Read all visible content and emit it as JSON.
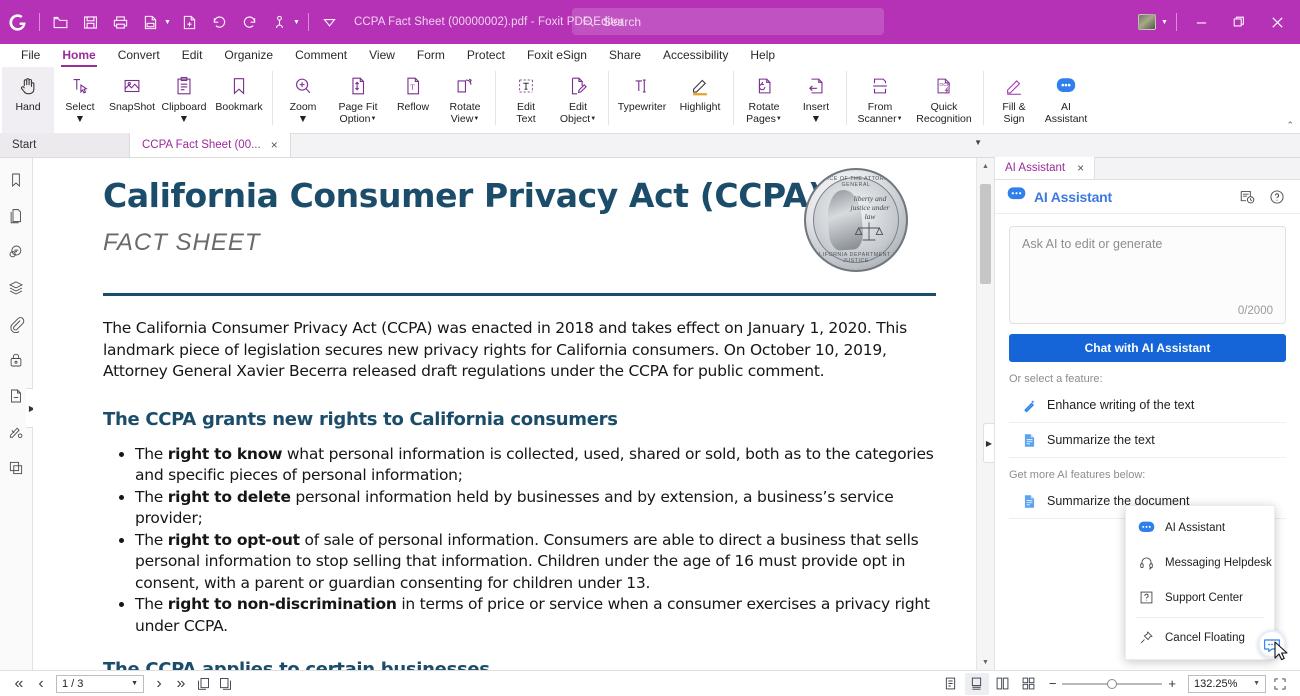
{
  "titlebar": {
    "logo": "foxit-logo-icon",
    "doc_title": "CCPA Fact Sheet (00000002).pdf - Foxit PDF Editor",
    "search_placeholder": "Search",
    "buttons": [
      "open-icon",
      "save-icon",
      "print-icon",
      "create-pdf-icon",
      "new-from-file-icon",
      "undo-icon",
      "redo-icon",
      "touch-mode-icon",
      "customize-toolbar-icon"
    ],
    "window": {
      "minimize": "–",
      "restore": "restore-icon",
      "close": "×"
    }
  },
  "menubar": {
    "items": [
      {
        "label": "File",
        "active": false
      },
      {
        "label": "Home",
        "active": true
      },
      {
        "label": "Convert",
        "active": false
      },
      {
        "label": "Edit",
        "active": false
      },
      {
        "label": "Organize",
        "active": false
      },
      {
        "label": "Comment",
        "active": false
      },
      {
        "label": "View",
        "active": false
      },
      {
        "label": "Form",
        "active": false
      },
      {
        "label": "Protect",
        "active": false
      },
      {
        "label": "Foxit eSign",
        "active": false
      },
      {
        "label": "Share",
        "active": false
      },
      {
        "label": "Accessibility",
        "active": false
      },
      {
        "label": "Help",
        "active": false
      }
    ]
  },
  "ribbon": {
    "groups": [
      {
        "items": [
          {
            "label": "Hand",
            "label2": "",
            "icon": "hand-icon",
            "caret": false,
            "selected": true
          },
          {
            "label": "Select",
            "label2": "",
            "icon": "select-icon",
            "caret": true,
            "selected": false
          },
          {
            "label": "SnapShot",
            "label2": "",
            "icon": "snapshot-icon",
            "caret": false,
            "selected": false
          },
          {
            "label": "Clipboard",
            "label2": "",
            "icon": "clipboard-icon",
            "caret": true,
            "selected": false
          },
          {
            "label": "Bookmark",
            "label2": "",
            "icon": "bookmark-icon",
            "caret": false,
            "selected": false
          }
        ]
      },
      {
        "items": [
          {
            "label": "Zoom",
            "label2": "",
            "icon": "zoom-icon",
            "caret": true,
            "selected": false
          },
          {
            "label": "Page Fit",
            "label2": "Option",
            "icon": "page-fit-icon",
            "caret": true,
            "selected": false
          },
          {
            "label": "Reflow",
            "label2": "",
            "icon": "reflow-icon",
            "caret": false,
            "selected": false
          },
          {
            "label": "Rotate",
            "label2": "View",
            "icon": "rotate-view-icon",
            "caret": true,
            "selected": false
          }
        ]
      },
      {
        "items": [
          {
            "label": "Edit",
            "label2": "Text",
            "icon": "edit-text-icon",
            "caret": false,
            "selected": false
          },
          {
            "label": "Edit",
            "label2": "Object",
            "icon": "edit-object-icon",
            "caret": true,
            "selected": false
          }
        ]
      },
      {
        "items": [
          {
            "label": "Typewriter",
            "label2": "",
            "icon": "typewriter-icon",
            "caret": false,
            "selected": false
          },
          {
            "label": "Highlight",
            "label2": "",
            "icon": "highlight-icon",
            "caret": false,
            "selected": false
          }
        ]
      },
      {
        "items": [
          {
            "label": "Rotate",
            "label2": "Pages",
            "icon": "rotate-pages-icon",
            "caret": true,
            "selected": false
          },
          {
            "label": "Insert",
            "label2": "",
            "icon": "insert-pages-icon",
            "caret": true,
            "selected": false
          }
        ]
      },
      {
        "items": [
          {
            "label": "From",
            "label2": "Scanner",
            "icon": "from-scanner-icon",
            "caret": true,
            "selected": false
          },
          {
            "label": "Quick",
            "label2": "Recognition",
            "icon": "ocr-icon",
            "caret": false,
            "selected": false
          }
        ]
      },
      {
        "items": [
          {
            "label": "Fill &",
            "label2": "Sign",
            "icon": "fill-sign-icon",
            "caret": false,
            "selected": false
          },
          {
            "label": "AI",
            "label2": "Assistant",
            "icon": "ai-assistant-icon",
            "caret": false,
            "selected": false
          }
        ]
      }
    ]
  },
  "tabstrip": {
    "tabs": [
      {
        "label": "Start",
        "active": false,
        "closable": false
      },
      {
        "label": "CCPA Fact Sheet (00...",
        "active": true,
        "closable": true
      }
    ],
    "close_glyph": "×",
    "overflow_caret": "▼"
  },
  "leftrail": {
    "items": [
      {
        "name": "bookmarks-icon"
      },
      {
        "name": "page-thumbnails-icon"
      },
      {
        "name": "comments-icon"
      },
      {
        "name": "layers-icon"
      },
      {
        "name": "attachments-icon"
      },
      {
        "name": "security-icon"
      },
      {
        "name": "fields-icon"
      },
      {
        "name": "signatures-icon"
      },
      {
        "name": "stamps-icon"
      }
    ],
    "expand_glyph": "▶"
  },
  "document": {
    "title": "California Consumer Privacy Act (CCPA)",
    "subtitle": "FACT SHEET",
    "seal": {
      "top_text": "OFFICE OF THE ATTORNEY GENERAL",
      "bottom_text": "CALIFORNIA DEPARTMENT OF JUSTICE",
      "motto": "liberty and justice under law"
    },
    "intro": "The California Consumer Privacy Act (CCPA) was enacted in 2018 and takes effect on January 1, 2020. This landmark piece of legislation secures new privacy rights for California consumers. On October 10, 2019, Attorney General Xavier Becerra released draft regulations under the CCPA for public comment.",
    "heading": "The CCPA grants new rights to California consumers",
    "bullets": [
      {
        "pre": "The ",
        "bold": "right to know",
        "post": " what personal information is collected, used, shared or sold, both as to the categories and specific pieces of personal information;"
      },
      {
        "pre": "The ",
        "bold": "right to delete",
        "post": " personal information held by businesses and by extension, a business’s service provider;"
      },
      {
        "pre": "The ",
        "bold": "right to opt-out",
        "post": " of sale of personal information. Consumers are able to direct a business that sells personal information to stop selling that information. Children under the age of 16 must provide opt in consent, with a parent or guardian consenting for children under 13."
      },
      {
        "pre": "The ",
        "bold": "right to non-discrimination",
        "post": " in terms of price or service when a consumer exercises a privacy right under CCPA."
      }
    ],
    "next_heading": "The CCPA applies to certain businesses"
  },
  "ai_panel": {
    "tab_label": "AI Assistant",
    "tab_close": "×",
    "header_title": "AI Assistant",
    "header_icons": [
      "history-icon",
      "help-icon"
    ],
    "input_placeholder": "Ask AI to edit or generate",
    "char_count": "0/2000",
    "cta_label": "Chat with AI Assistant",
    "feature_label": "Or select a feature:",
    "features": [
      {
        "label": "Enhance writing of the text",
        "icon": "magic-wand-icon"
      },
      {
        "label": "Summarize the text",
        "icon": "summarize-icon"
      }
    ],
    "more_label": "Get more AI features below:",
    "more_features": [
      {
        "label": "Summarize the document",
        "icon": "summarize-doc-icon"
      }
    ]
  },
  "context_menu": {
    "items": [
      {
        "label": "AI Assistant",
        "icon": "ai-assistant-icon"
      },
      {
        "label": "Messaging Helpdesk",
        "icon": "headset-icon"
      },
      {
        "label": "Support Center",
        "icon": "question-box-icon"
      },
      {
        "label": "Cancel Floating",
        "icon": "pin-icon"
      }
    ]
  },
  "statusbar": {
    "first_page": "«",
    "prev_page": "‹",
    "page_value": "1 / 3",
    "next_page": "›",
    "last_page": "»",
    "view_buttons": [
      "single-page-icon",
      "continuous-icon"
    ],
    "layout_buttons": [
      "single-page-view-icon",
      "continuous-scroll-icon",
      "facing-pages-icon",
      "facing-continuous-icon"
    ],
    "zoom_out": "−",
    "zoom_in": "+",
    "zoom_value": "132.25%",
    "fullscreen": "fullscreen-icon"
  },
  "colors": {
    "brand_purple": "#b531b5",
    "accent_purple": "#9b2a9b",
    "doc_navy": "#1b4d6b",
    "ai_blue": "#1564d8",
    "ai_title_blue": "#3c7ae0"
  }
}
